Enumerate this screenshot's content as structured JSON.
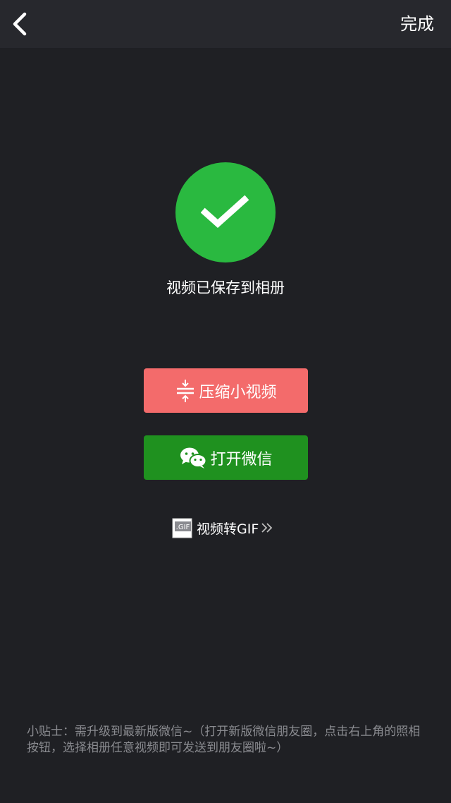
{
  "header": {
    "back_icon": "chevron-left-icon",
    "done_label": "完成"
  },
  "status": {
    "icon": "checkmark-icon",
    "circle_color": "#2ab940",
    "message": "视频已保存到相册"
  },
  "actions": {
    "compress": {
      "icon": "compress-icon",
      "label": "压缩小视频",
      "color": "#f36b6b"
    },
    "wechat": {
      "icon": "wechat-icon",
      "label": "打开微信",
      "color": "#1f911f"
    }
  },
  "gif_link": {
    "icon": "gif-file-icon",
    "icon_text": ".GIF",
    "label": "视频转GIF",
    "chevron": "double-chevron-right-icon"
  },
  "tip": {
    "text": "小贴士：需升级到最新版微信~（打开新版微信朋友圈，点击右上角的照相按钮，选择相册任意视频即可发送到朋友圈啦~）"
  }
}
